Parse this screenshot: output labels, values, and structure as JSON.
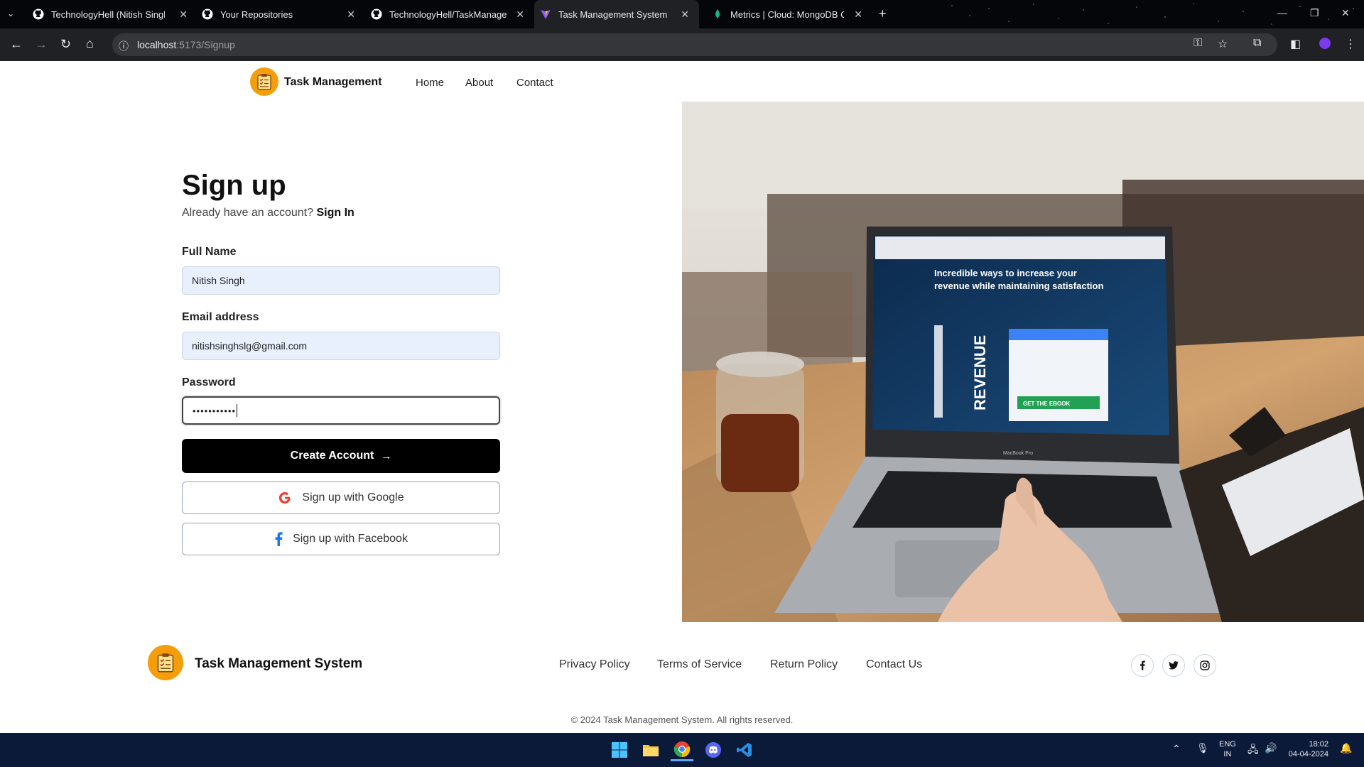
{
  "browser": {
    "tabs": [
      {
        "title": "TechnologyHell (Nitish Singh)",
        "icon": "github-icon"
      },
      {
        "title": "Your Repositories",
        "icon": "github-icon"
      },
      {
        "title": "TechnologyHell/TaskManageme",
        "icon": "github-icon"
      },
      {
        "title": "Task Management System",
        "icon": "vite-icon"
      },
      {
        "title": "Metrics | Cloud: MongoDB Clou",
        "icon": "mongodb-icon"
      }
    ],
    "url_host": "localhost",
    "url_path": ":5173/Signup"
  },
  "nav": {
    "brand": "Task Management",
    "links": [
      "Home",
      "About",
      "Contact"
    ]
  },
  "form": {
    "title": "Sign up",
    "subtitle": "Already have an account?",
    "signin_link": "Sign In",
    "fullname_label": "Full Name",
    "fullname_value": "Nitish Singh",
    "email_label": "Email address",
    "email_value": "nitishsinghslg@gmail.com",
    "password_label": "Password",
    "password_masked": "•••••••••••",
    "create_button": "Create Account",
    "google_button": "Sign up with Google",
    "facebook_button": "Sign up with Facebook"
  },
  "hero": {
    "screen_headline": "Incredible ways to increase your revenue while maintaining satisfaction",
    "screen_word": "REVENUE",
    "screen_cta": "GET THE EBOOK",
    "laptop_label": "MacBook Pro"
  },
  "footer": {
    "brand": "Task Management System",
    "links": [
      "Privacy Policy",
      "Terms of Service",
      "Return Policy",
      "Contact Us"
    ],
    "social": [
      "facebook-icon",
      "twitter-icon",
      "instagram-icon"
    ],
    "copyright": "© 2024 Task Management System. All rights reserved."
  },
  "taskbar": {
    "lang": "ENG",
    "region": "IN",
    "time": "18:02",
    "date": "04-04-2024"
  },
  "colors": {
    "accent": "#f59e0b",
    "primary_button": "#000000",
    "google_red": "#ea4335",
    "facebook_blue": "#1877f2"
  }
}
